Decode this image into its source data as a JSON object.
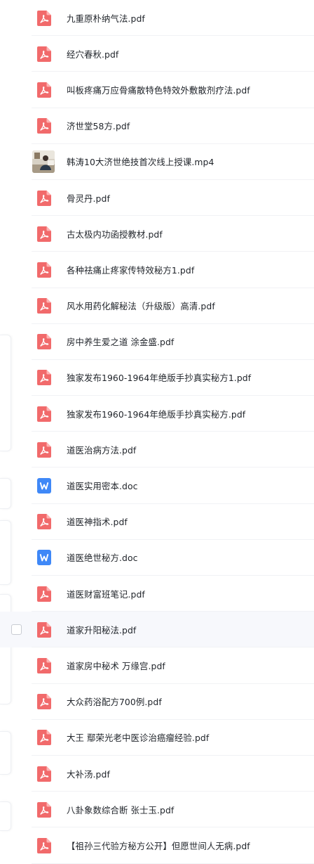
{
  "colors": {
    "pdf_icon": "#f16a6b",
    "doc_icon": "#3f88f7",
    "text": "#1f2329",
    "hover_row": "#f7f8fc"
  },
  "files": [
    {
      "name": "九重原朴纳气法.pdf",
      "type": "pdf",
      "icon": "pdf-icon"
    },
    {
      "name": "经穴春秋.pdf",
      "type": "pdf",
      "icon": "pdf-icon"
    },
    {
      "name": "叫板疼痛万应骨痛散特色特效外敷散剂疗法.pdf",
      "type": "pdf",
      "icon": "pdf-icon"
    },
    {
      "name": "济世堂58方.pdf",
      "type": "pdf",
      "icon": "pdf-icon"
    },
    {
      "name": "韩涛10大济世绝技首次线上授课.mp4",
      "type": "mp4",
      "icon": "video-thumbnail"
    },
    {
      "name": "骨灵丹.pdf",
      "type": "pdf",
      "icon": "pdf-icon"
    },
    {
      "name": "古太极内功函授教材.pdf",
      "type": "pdf",
      "icon": "pdf-icon"
    },
    {
      "name": "各种祛痛止疼家传特效秘方1.pdf",
      "type": "pdf",
      "icon": "pdf-icon"
    },
    {
      "name": "风水用药化解秘法（升级版）高清.pdf",
      "type": "pdf",
      "icon": "pdf-icon"
    },
    {
      "name": "房中养生爱之道 涂金盛.pdf",
      "type": "pdf",
      "icon": "pdf-icon"
    },
    {
      "name": "独家发布1960-1964年绝版手抄真实秘方1.pdf",
      "type": "pdf",
      "icon": "pdf-icon"
    },
    {
      "name": "独家发布1960-1964年绝版手抄真实秘方.pdf",
      "type": "pdf",
      "icon": "pdf-icon"
    },
    {
      "name": "道医治病方法.pdf",
      "type": "pdf",
      "icon": "pdf-icon"
    },
    {
      "name": "道医实用密本.doc",
      "type": "doc",
      "icon": "doc-icon"
    },
    {
      "name": "道医神指术.pdf",
      "type": "pdf",
      "icon": "pdf-icon"
    },
    {
      "name": "道医绝世秘方.doc",
      "type": "doc",
      "icon": "doc-icon"
    },
    {
      "name": "道医财富班笔记.pdf",
      "type": "pdf",
      "icon": "pdf-icon"
    },
    {
      "name": "道家升阳秘法.pdf",
      "type": "pdf",
      "icon": "pdf-icon",
      "hovered": true
    },
    {
      "name": "道家房中秘术 万缘宫.pdf",
      "type": "pdf",
      "icon": "pdf-icon"
    },
    {
      "name": "大众药浴配方700例.pdf",
      "type": "pdf",
      "icon": "pdf-icon"
    },
    {
      "name": "大王 鄢荣光老中医诊治癌瘤经验.pdf",
      "type": "pdf",
      "icon": "pdf-icon"
    },
    {
      "name": "大补汤.pdf",
      "type": "pdf",
      "icon": "pdf-icon"
    },
    {
      "name": "八卦象数综合断 张士玉.pdf",
      "type": "pdf",
      "icon": "pdf-icon"
    },
    {
      "name": "【祖孙三代验方秘方公开】但愿世间人无病.pdf",
      "type": "pdf",
      "icon": "pdf-icon"
    }
  ]
}
